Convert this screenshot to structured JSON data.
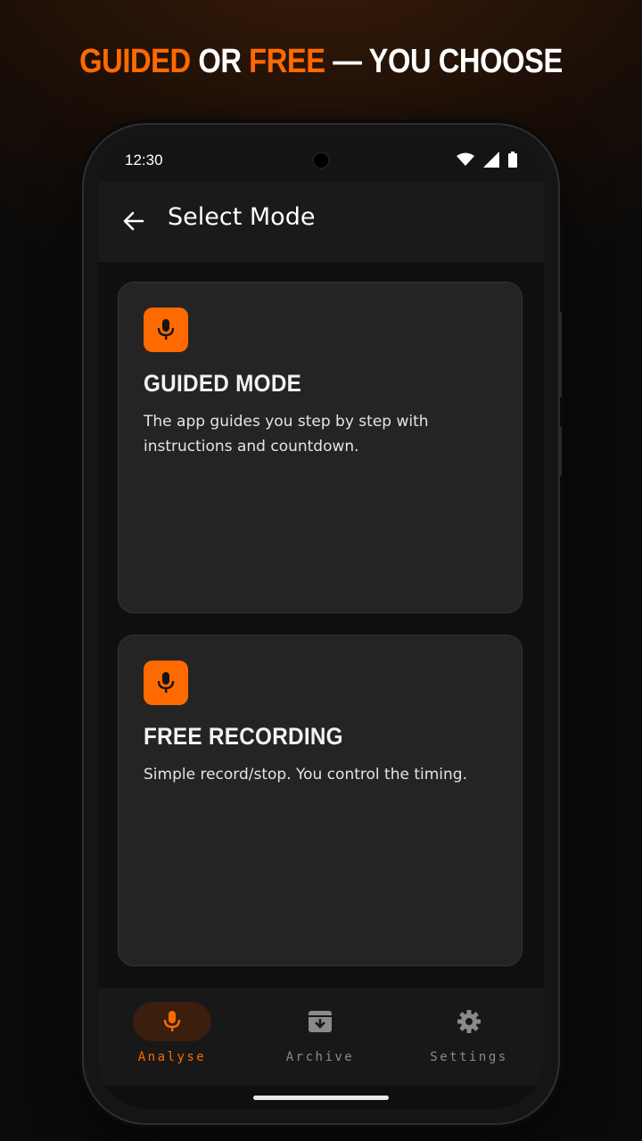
{
  "headline": {
    "part1": "GUIDED",
    "part2": " OR ",
    "part3": "FREE",
    "part4": " — YOU CHOOSE"
  },
  "status_bar": {
    "time": "12:30"
  },
  "app_bar": {
    "title": "Select Mode"
  },
  "cards": [
    {
      "title": "GUIDED MODE",
      "description": "The app guides you step by step with instructions and countdown.",
      "icon": "microphone-icon"
    },
    {
      "title": "FREE RECORDING",
      "description": "Simple record/stop. You control the timing.",
      "icon": "microphone-icon"
    }
  ],
  "nav": [
    {
      "label": "Analyse",
      "icon": "microphone-icon",
      "active": true
    },
    {
      "label": "Archive",
      "icon": "archive-icon",
      "active": false
    },
    {
      "label": "Settings",
      "icon": "gear-icon",
      "active": false
    }
  ],
  "colors": {
    "accent": "#ff6a00",
    "card_bg": "#242424",
    "screen_bg": "#0f0f0f"
  }
}
